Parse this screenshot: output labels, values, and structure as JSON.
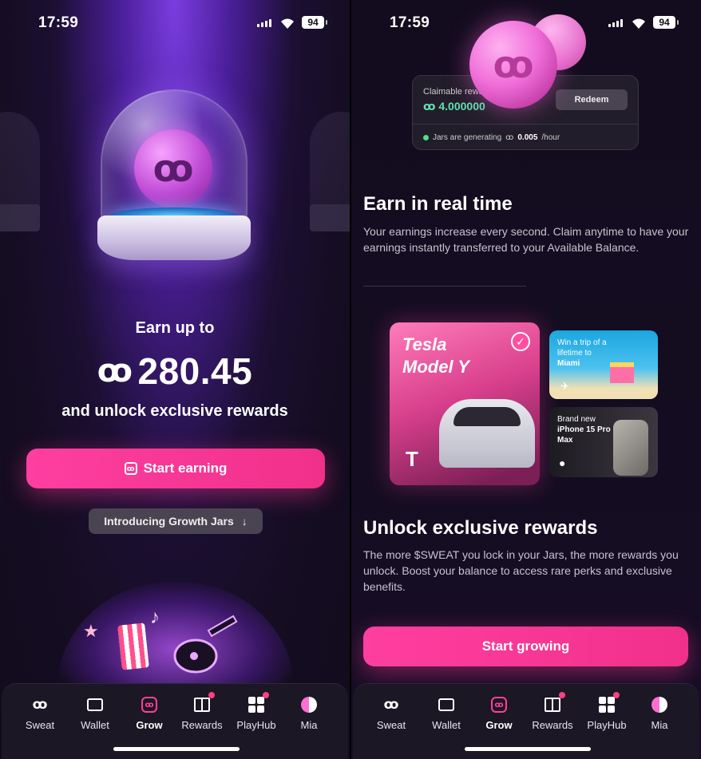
{
  "status": {
    "time": "17:59",
    "battery": "94"
  },
  "left": {
    "earn_up": "Earn up to",
    "amount": "280.45",
    "unlock": "and unlock exclusive rewards",
    "start_button": "Start earning",
    "intro_chip": "Introducing Growth Jars"
  },
  "right": {
    "claim_label": "Claimable rewa",
    "claim_value": "4.000000",
    "redeem": "Redeem",
    "generating_prefix": "Jars are generating",
    "generating_rate": "0.005",
    "generating_unit": "/hour",
    "section1_title": "Earn in real time",
    "section1_text": "Your earnings increase every second. Claim anytime to have your earnings instantly transferred to your Available Balance.",
    "tesla_line1": "Tesla",
    "tesla_line2": "Model Y",
    "miami_line1": "Win a trip of a",
    "miami_line2": "lifetime to",
    "miami_line3": "Miami",
    "iphone_line1": "Brand new",
    "iphone_line2": "iPhone 15 Pro",
    "iphone_line3": "Max",
    "section2_title": "Unlock exclusive rewards",
    "section2_text": "The more $SWEAT you lock in your Jars, the more rewards you unlock. Boost your balance to access rare perks and exclusive benefits.",
    "start_button": "Start growing"
  },
  "tabbar": {
    "items": [
      "Sweat",
      "Wallet",
      "Grow",
      "Rewards",
      "PlayHub",
      "Mia"
    ],
    "active": "Grow"
  },
  "colors": {
    "accent": "#ff3fa0",
    "green": "#5fe0b0"
  }
}
